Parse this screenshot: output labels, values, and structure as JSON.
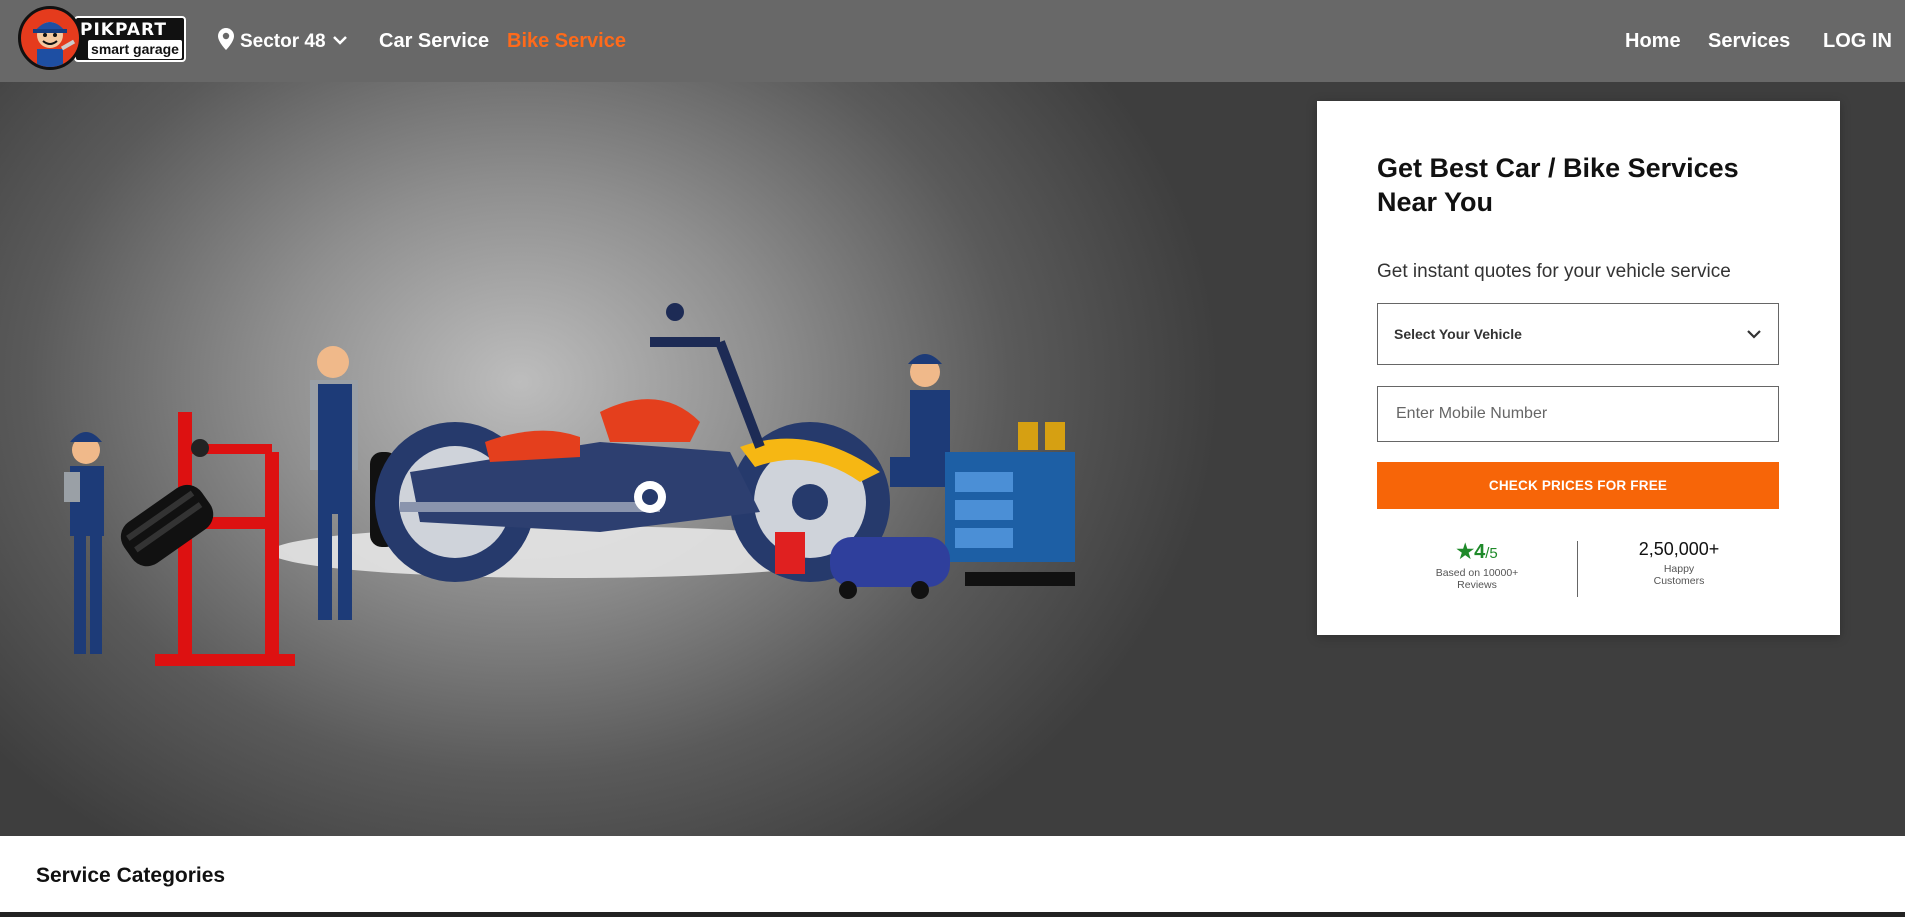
{
  "header": {
    "logo": {
      "brand": "PIKPART",
      "tagline": "smart garage"
    },
    "location": "Sector 48",
    "nav": {
      "car_service": "Car Service",
      "bike_service": "Bike Service",
      "home": "Home",
      "services": "Services",
      "login": "LOG IN"
    }
  },
  "form": {
    "title": "Get Best Car / Bike Services Near You",
    "subtitle": "Get instant quotes for your vehicle service",
    "vehicle_select": "Select Your Vehicle",
    "mobile_placeholder": "Enter Mobile Number",
    "cta": "CHECK PRICES FOR FREE",
    "rating": {
      "star": "★",
      "value": "4",
      "denominator": "/5",
      "caption": "Based on 10000+ Reviews"
    },
    "customers": {
      "value": "2,50,000+",
      "caption": "Happy Customers"
    }
  },
  "section": {
    "title": "Service Categories"
  },
  "colors": {
    "accent": "#f76508",
    "header_bg": "#686868",
    "rating_green": "#1f8a2a"
  }
}
